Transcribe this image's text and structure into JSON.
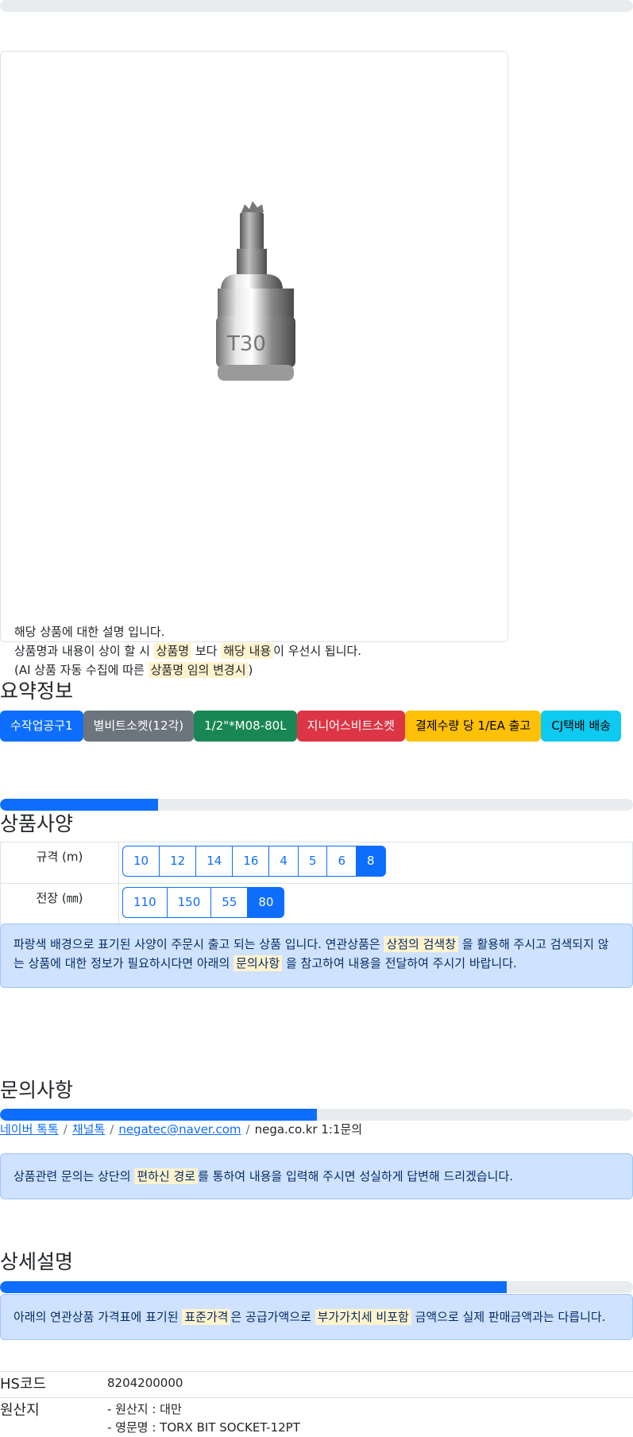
{
  "progress": {
    "top_bar": 0,
    "spec_bar": 0.25,
    "inquiry_bar": 0.5,
    "detail_bar": 0.8
  },
  "product": {
    "image_label": "T30",
    "note_line1": "해당 상품에 대한 설명 입니다.",
    "note_line2_a": "상품명과 내용이 상이 할 시 ",
    "note_line2_hl1": "상품명",
    "note_line2_b": " 보다 ",
    "note_line2_hl2": "해당 내용",
    "note_line2_c": "이 우선시 됩니다.",
    "note_line3_a": "(AI 상품 자동 수집에 따른 ",
    "note_line3_hl": "상품명 임의 변경시",
    "note_line3_b": ")"
  },
  "summary": {
    "title": "요약정보",
    "badges": [
      {
        "label": "수작업공구1",
        "color": "#0d6efd",
        "text_color": "#ffffff"
      },
      {
        "label": "별비트소켓(12각)",
        "color": "#6c757d",
        "text_color": "#ffffff"
      },
      {
        "label": "1/2\"*M08-80L",
        "color": "#198754",
        "text_color": "#ffffff"
      },
      {
        "label": "지니어스비트소켓",
        "color": "#dc3545",
        "text_color": "#ffffff"
      },
      {
        "label": "결제수량 당 1/EA 출고",
        "color": "#ffc107",
        "text_color": "#000000"
      },
      {
        "label": "CJ택배 배송",
        "color": "#0dcaf0",
        "text_color": "#000000"
      }
    ]
  },
  "spec": {
    "title": "상품사양",
    "rows": [
      {
        "label": "규격 (m)",
        "options": [
          "10",
          "12",
          "14",
          "16",
          "4",
          "5",
          "6",
          "8"
        ],
        "selected": "8"
      },
      {
        "label": "전장 (㎜)",
        "options": [
          "110",
          "150",
          "55",
          "80"
        ],
        "selected": "80"
      }
    ],
    "notice_a": "파랑색 배경으로 표기된 사양이 주문시 출고 되는 상품 입니다. 연관상품은 ",
    "notice_hl1": "상점의 검색창",
    "notice_b": " 을 활용해 주시고 검색되지 않는 상품에 대한 정보가 필요하시다면 아래의 ",
    "notice_hl2": "문의사항",
    "notice_c": " 을 참고하여 내용을 전달하여 주시기 바랍니다."
  },
  "inquiry": {
    "title": "문의사항",
    "link_naver": "네이버 톡톡",
    "link_channel": "채널톡",
    "link_email": "negatec@naver.com",
    "text_nega": "nega.co.kr 1:1문의",
    "separator": "/",
    "notice_a": "상품관련 문의는 상단의 ",
    "notice_hl": "편하신 경로",
    "notice_b": "를 통하여 내용을 입력해 주시면 성실하게 답변해 드리겠습니다."
  },
  "detail": {
    "title": "상세설명",
    "notice_a": "아래의 연관상품 가격표에 표기된 ",
    "notice_hl1": "표준가격",
    "notice_b": "은 공급가액으로 ",
    "notice_hl2": "부가가치세 비포함",
    "notice_c": " 금액으로 실제 판매금액과는 다릅니다.",
    "hs_key": "HS코드",
    "hs_value": "8204200000",
    "origin_key": "원산지",
    "origin_line1": "- 원산지 : 대만",
    "origin_line2": "- 영문명 : TORX BIT SOCKET-12PT"
  }
}
